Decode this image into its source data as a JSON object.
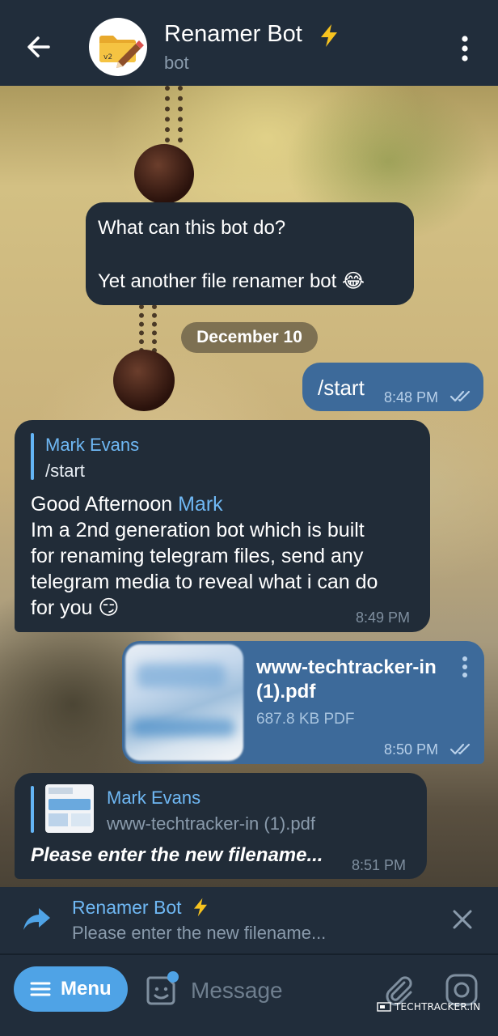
{
  "header": {
    "title": "Renamer Bot",
    "title_badge_icon": "lightning-icon",
    "subtitle": "bot",
    "avatar_badge": "v2"
  },
  "messages": {
    "intro": {
      "question": "What can this bot do?",
      "answer": "Yet another file renamer bot 😂"
    },
    "date_separator": "December 10",
    "start": {
      "text": "/start",
      "time": "8:48 PM"
    },
    "greeting": {
      "quote_name": "Mark Evans",
      "quote_text": "/start",
      "line1_prefix": "Good Afternoon ",
      "line1_mention": "Mark",
      "line2": "Im a 2nd generation bot which is built",
      "line3": "for renaming telegram files, send any",
      "line4": "telegram media to reveal what i can do",
      "line5": "for you 😏",
      "time": "8:49 PM"
    },
    "file": {
      "name_line1": "www-techtracker-in",
      "name_line2": "(1).pdf",
      "size": "687.8 KB PDF",
      "time": "8:50 PM"
    },
    "prompt": {
      "quote_name": "Mark Evans",
      "quote_text": "www-techtracker-in (1).pdf",
      "text": "Please enter the new filename...",
      "time": "8:51 PM"
    }
  },
  "reply_panel": {
    "name": "Renamer Bot",
    "text": "Please enter the new filename..."
  },
  "composer": {
    "menu_label": "Menu",
    "placeholder": "Message",
    "watermark": "TECHTRACKER.IN"
  },
  "colors": {
    "header_bg": "#212d3b",
    "incoming_bubble": "#212c38",
    "outgoing_bubble": "#3d6a9a",
    "accent": "#6fb8f4",
    "menu_button": "#4fa3e6",
    "bolt": "#f7c31f"
  }
}
